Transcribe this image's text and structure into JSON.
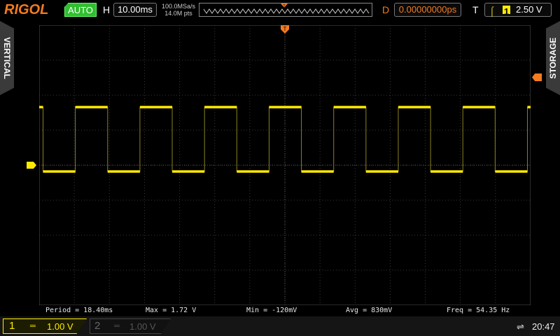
{
  "header": {
    "brand": "RIGOL",
    "run_mode": "AUTO",
    "horizontal_label": "H",
    "time_base": "10.00ms",
    "sample_rate": "100.0MSa/s",
    "memory_depth": "14.0M pts",
    "delay_label": "D",
    "delay_value": "0.00000000ps",
    "trigger_label": "T",
    "trigger_channel": "1",
    "trigger_level": "2.50 V"
  },
  "side_tabs": {
    "left": "VERTICAL",
    "right": "STORAGE"
  },
  "markers": {
    "trigger_marker": "T",
    "channel_marker": "1"
  },
  "measurements": {
    "period": "Period = 18.40ms",
    "max": "Max = 1.72 V",
    "min": "Min = -120mV",
    "avg": "Avg = 830mV",
    "freq": "Freq = 54.35 Hz"
  },
  "channels": [
    {
      "number": "1",
      "coupling": "═",
      "scale": "1.00 V",
      "active": true
    },
    {
      "number": "2",
      "coupling": "═",
      "scale": "1.00 V",
      "active": false
    }
  ],
  "status": {
    "usb_icon": "usb-icon",
    "time": "20:47"
  },
  "waveform": {
    "period_ms": 18.4,
    "high_v": 1.72,
    "low_v": -0.12,
    "duty_fraction": 0.5,
    "first_rise_ms": -4.5,
    "time_per_div_ms": 10,
    "volts_per_div": 1,
    "h_divisions": 14,
    "v_divisions": 8,
    "color": "#ffeb00"
  },
  "colors": {
    "trace": "#ffeb00",
    "accent": "#f47b20",
    "auto": "#2fbf2f",
    "grid": "#3a3a3a"
  }
}
